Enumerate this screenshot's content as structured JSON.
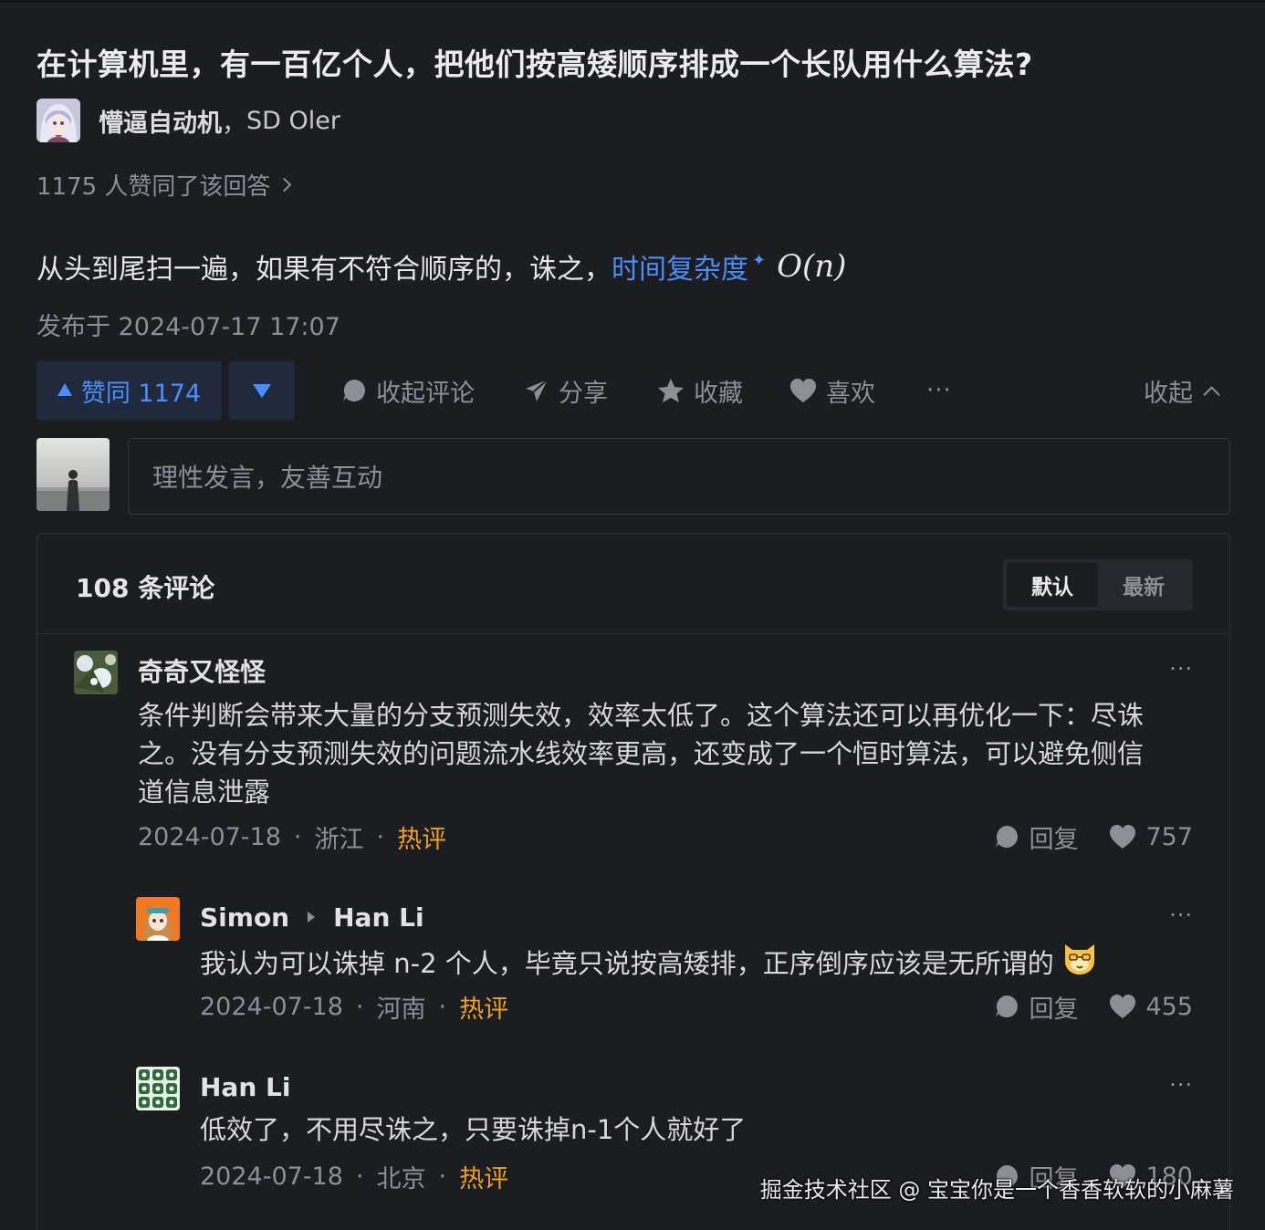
{
  "question": {
    "title": "在计算机里，有一百亿个人，把他们按高矮顺序排成一个长队用什么算法?"
  },
  "author": {
    "name": "懵逼自动机",
    "separator": "，",
    "bio": "SD Oler"
  },
  "agree_text": "1175 人赞同了该回答",
  "answer": {
    "text": "从头到尾扫一遍，如果有不符合顺序的，诛之，",
    "link": "时间复杂度",
    "math": "O(n)"
  },
  "publish_text": "发布于 2024-07-17 17:07",
  "toolbar": {
    "upvote_label": "赞同 1174",
    "collapse_comments": "收起评论",
    "share": "分享",
    "favorite": "收藏",
    "like": "喜欢",
    "more": "···",
    "collapse": "收起"
  },
  "composer": {
    "placeholder": "理性发言，友善互动"
  },
  "comments_panel": {
    "count_label": "108 条评论",
    "sort_tabs": [
      "默认",
      "最新"
    ],
    "active_tab": "默认"
  },
  "comments": [
    {
      "author": "奇奇又怪怪",
      "lines": [
        "条件判断会带来大量的分支预测失效，效率太低了。这个算法还可以再优化一下：尽诛",
        "之。没有分支预测失效的问题流水线效率更高，还变成了一个恒时算法，可以避免侧信",
        "道信息泄露"
      ],
      "date": "2024-07-18",
      "location": "浙江",
      "tag": "热评",
      "reply": "回复",
      "likes": "757",
      "more": "···"
    },
    {
      "author": "Simon",
      "reply_to": "Han Li",
      "text": "我认为可以诛掉 n-2 个人，毕竟只说按高矮排，正序倒序应该是无所谓的",
      "emoji": "cat-face-emoji",
      "date": "2024-07-18",
      "location": "河南",
      "tag": "热评",
      "reply": "回复",
      "likes": "455",
      "more": "···"
    },
    {
      "author": "Han Li",
      "text": "低效了，不用尽诛之，只要诛掉n-1个人就好了",
      "date": "2024-07-18",
      "location": "北京",
      "tag": "热评",
      "reply": "回复",
      "likes": "180",
      "more": "···"
    }
  ],
  "dot_sep": "·",
  "watermark": "掘金技术社区 @ 宝宝你是一个香香软软的小麻薯",
  "colors": {
    "background": "#1c1d21",
    "accent_blue": "#4d8dfb",
    "hot_orange": "#f0a020",
    "muted": "#8c8f96"
  }
}
